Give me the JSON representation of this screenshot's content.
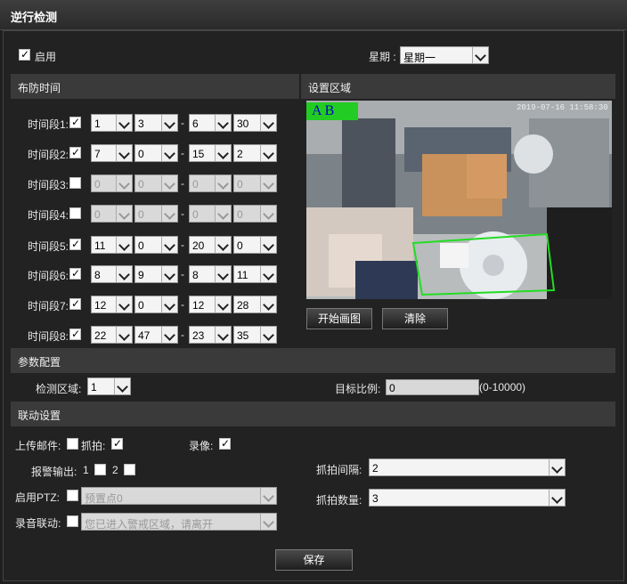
{
  "title": "逆行检测",
  "enable": {
    "label": "启用",
    "checked": true
  },
  "weekday": {
    "label": "星期 :",
    "value": "星期一"
  },
  "sections": {
    "schedule": "布防时间",
    "area": "设置区域",
    "params": "参数配置",
    "linkage": "联动设置"
  },
  "periods": [
    {
      "label": "时间段1:",
      "enabled": true,
      "v": [
        "1",
        "3",
        "6",
        "30"
      ]
    },
    {
      "label": "时间段2:",
      "enabled": true,
      "v": [
        "7",
        "0",
        "15",
        "2"
      ]
    },
    {
      "label": "时间段3:",
      "enabled": false,
      "v": [
        "0",
        "0",
        "0",
        "0"
      ]
    },
    {
      "label": "时间段4:",
      "enabled": false,
      "v": [
        "0",
        "0",
        "0",
        "0"
      ]
    },
    {
      "label": "时间段5:",
      "enabled": true,
      "v": [
        "11",
        "0",
        "20",
        "0"
      ]
    },
    {
      "label": "时间段6:",
      "enabled": true,
      "v": [
        "8",
        "9",
        "8",
        "11"
      ]
    },
    {
      "label": "时间段7:",
      "enabled": true,
      "v": [
        "12",
        "0",
        "12",
        "28"
      ]
    },
    {
      "label": "时间段8:",
      "enabled": true,
      "v": [
        "22",
        "47",
        "23",
        "35"
      ]
    }
  ],
  "separator": "-",
  "video": {
    "zone_label": "A  B",
    "timestamp": "2019-07-16 11:58:30"
  },
  "buttons": {
    "start_draw": "开始画图",
    "clear": "清除",
    "save": "保存"
  },
  "params": {
    "region_label": "检测区域:",
    "region_value": "1",
    "ratio_label": "目标比例:",
    "ratio_value": "0",
    "ratio_hint": "(0-10000)"
  },
  "linkage": {
    "email_label": "上传邮件:",
    "email_checked": false,
    "snapshot_label": "抓拍:",
    "snapshot_checked": true,
    "record_label": "录像:",
    "record_checked": true,
    "alarm_out_label": "报警输出:",
    "alarm_out_1": "1",
    "alarm_out_2": "2",
    "ptz_label": "启用PTZ:",
    "ptz_value": "预置点0",
    "audio_label": "录音联动:",
    "audio_value": "您已进入警戒区域，请离开",
    "interval_label": "抓拍间隔:",
    "interval_value": "2",
    "count_label": "抓拍数量:",
    "count_value": "3"
  },
  "colors": {
    "zone": "#22dd22",
    "background": "#1f1f1f",
    "section": "#3a3a3a"
  }
}
